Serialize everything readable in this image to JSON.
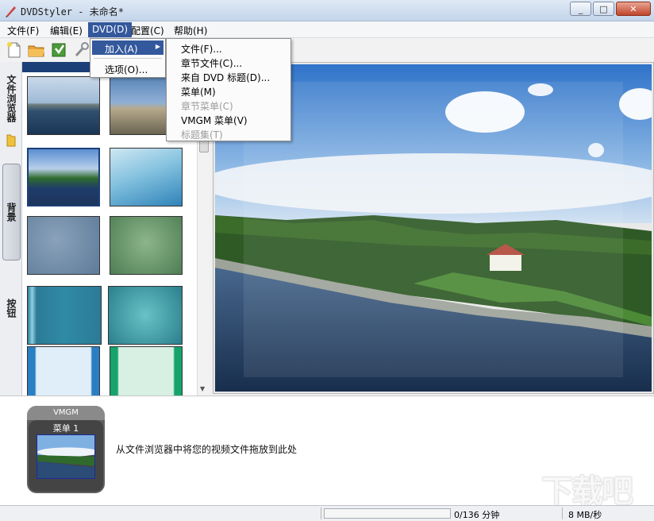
{
  "window": {
    "title": "DVDStyler - 未命名*",
    "buttons": [
      "_",
      "□",
      "✕"
    ]
  },
  "menubar": {
    "items": [
      "文件(F)",
      "编辑(E)",
      "DVD(D)",
      "配置(C)",
      "帮助(H)"
    ]
  },
  "dvd_menu": {
    "items": [
      "加入(A)",
      "选项(O)..."
    ],
    "submenu": [
      {
        "label": "文件(F)...",
        "enabled": true
      },
      {
        "label": "章节文件(C)...",
        "enabled": true
      },
      {
        "label": "来自 DVD 标题(D)...",
        "enabled": true
      },
      {
        "label": "菜单(M)",
        "enabled": true
      },
      {
        "label": "章节菜单(C)",
        "enabled": false
      },
      {
        "label": "VMGM 菜单(V)",
        "enabled": true
      },
      {
        "label": "标题集(T)",
        "enabled": false
      }
    ]
  },
  "toolbar": {
    "icons": [
      "new-file-icon",
      "open-folder-icon",
      "save-icon",
      "settings-wrench-icon"
    ]
  },
  "side_tabs": [
    "文件浏览器",
    "背景",
    "按钮"
  ],
  "bottom": {
    "vmgm_label": "VMGM",
    "menu_label": "菜单 1",
    "drop_hint": "从文件浏览器中将您的视频文件拖放到此处"
  },
  "status": {
    "time": "0/136 分钟",
    "speed": "8 MB/秒",
    "progress": 0
  },
  "watermark": "下载吧",
  "colors": {
    "menu_highlight": "#33589c",
    "title_bar": "#c3d5ea"
  }
}
